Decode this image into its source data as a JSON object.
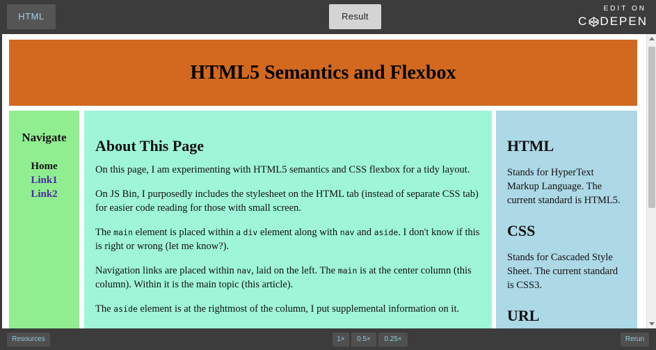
{
  "topbar": {
    "html_tab": "HTML",
    "result_tab": "Result",
    "codepen_edit": "EDIT ON",
    "codepen_brand_left": "C",
    "codepen_brand_right": "DEPEN"
  },
  "page": {
    "title": "HTML5 Semantics and Flexbox",
    "nav": {
      "heading": "Navigate",
      "items": [
        {
          "label": "Home"
        },
        {
          "label": "Link1"
        },
        {
          "label": "Link2"
        }
      ]
    },
    "main": {
      "heading": "About This Page",
      "p1": "On this page, I am experimenting with HTML5 semantics and CSS flexbox for a tidy layout.",
      "p2": "On JS Bin, I purposedly includes the stylesheet on the HTML tab (instead of separate CSS tab) for easier code reading for those with small screen.",
      "p3": {
        "t1": "The ",
        "c1": "main",
        "t2": " element is placed within a ",
        "c2": "div",
        "t3": " element along with ",
        "c3": "nav",
        "t4": " and ",
        "c4": "aside",
        "t5": ". I don't know if this is right or wrong (let me know?)."
      },
      "p4": {
        "t1": "Navigation links are placed within ",
        "c1": "nav",
        "t2": ", laid on the left. The ",
        "c2": "main",
        "t3": " is at the center column (this column). Within it is the main topic (this article)."
      },
      "p5": {
        "t1": "The ",
        "c1": "aside",
        "t2": " element is at the rightmost of the column, I put supplemental information on it."
      }
    },
    "aside": {
      "html_heading": "HTML",
      "html_text": "Stands for HyperText Markup Language. The current standard is HTML5.",
      "css_heading": "CSS",
      "css_text": "Stands for Cascaded Style Sheet. The current standard is CSS3.",
      "url_heading": "URL"
    }
  },
  "bottombar": {
    "resources": "Resources",
    "zoom_1x": "1×",
    "zoom_05x": "0.5×",
    "zoom_025x": "0.25×",
    "rerun": "Rerun"
  },
  "colors": {
    "header": "#d2691e",
    "nav": "#90ee90",
    "main": "#9ff5d8",
    "aside": "#add8e6"
  }
}
